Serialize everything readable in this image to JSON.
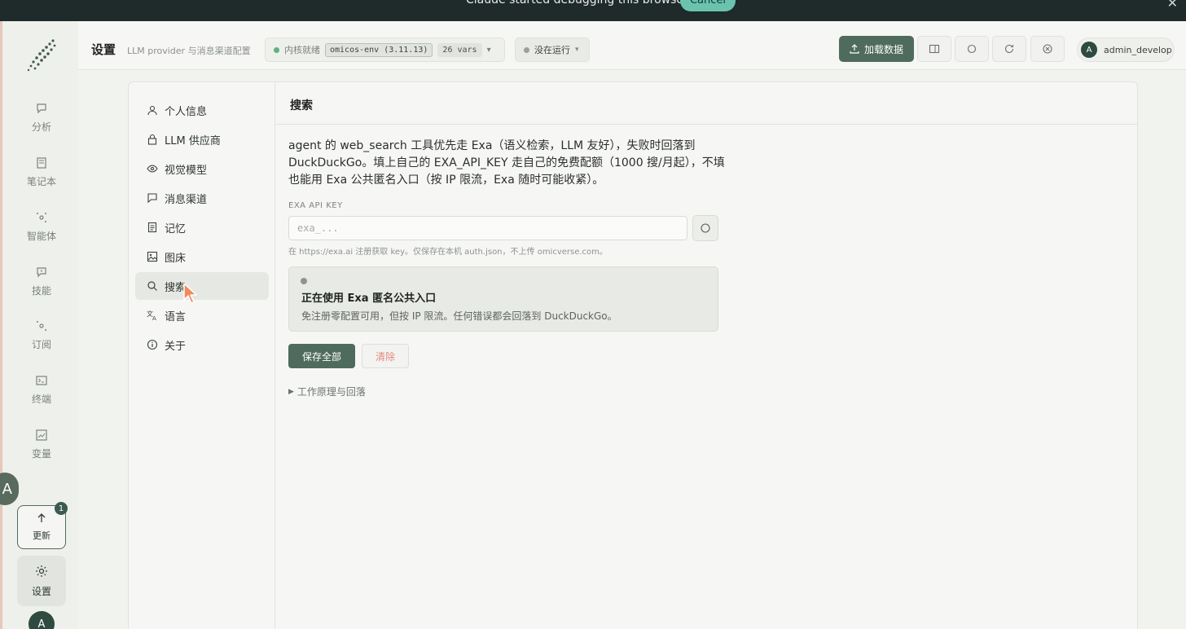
{
  "banner": {
    "message": "Claude started debugging this browser",
    "cancel_label": "Cancel",
    "close_glyph": "✕"
  },
  "leftnav": {
    "items": [
      {
        "label": "分析",
        "icon": "chat-icon"
      },
      {
        "label": "笔记本",
        "icon": "notebook-icon"
      },
      {
        "label": "智能体",
        "icon": "agent-icon"
      },
      {
        "label": "技能",
        "icon": "skill-icon"
      },
      {
        "label": "订阅",
        "icon": "subscription-icon"
      },
      {
        "label": "终端",
        "icon": "terminal-icon"
      },
      {
        "label": "变量",
        "icon": "variables-icon"
      }
    ],
    "update_label": "更新",
    "update_count": "1",
    "settings_label": "设置",
    "avatar_letter": "A",
    "lang_glyph": "A"
  },
  "header": {
    "title": "设置",
    "subtitle": "LLM provider 与消息渠道配置",
    "kernel_status": "内核就绪",
    "env_chip": "omicos-env (3.11.13)",
    "vars_chip": "26 vars",
    "run_status": "没在运行",
    "load_button": "加载数据",
    "user_initial": "A",
    "user_name": "admin_develop"
  },
  "settings_nav": [
    {
      "label": "个人信息",
      "icon": "user-icon"
    },
    {
      "label": "LLM 供应商",
      "icon": "lock-icon"
    },
    {
      "label": "视觉模型",
      "icon": "eye-icon"
    },
    {
      "label": "消息渠道",
      "icon": "message-icon"
    },
    {
      "label": "记忆",
      "icon": "memory-icon"
    },
    {
      "label": "图床",
      "icon": "image-icon"
    },
    {
      "label": "搜索",
      "icon": "search-icon",
      "active": true
    },
    {
      "label": "语言",
      "icon": "translate-icon"
    },
    {
      "label": "关于",
      "icon": "info-icon"
    }
  ],
  "search": {
    "heading": "搜索",
    "description": "agent 的 web_search 工具优先走 Exa（语义检索，LLM 友好），失败时回落到 DuckDuckGo。填上自己的 EXA_API_KEY 走自己的免费配额（1000 搜/月起），不填也能用 Exa 公共匿名入口（按 IP 限流，Exa 随时可能收紧）。",
    "api_key_label": "EXA API KEY",
    "api_key_value": "",
    "api_key_placeholder": "exa_...",
    "hint": "在 https://exa.ai 注册获取 key。仅保存在本机 auth.json，不上传 omicverse.com。",
    "status_title": "正在使用 Exa 匿名公共入口",
    "status_desc": "免注册零配置可用，但按 IP 限流。任何错误都会回落到 DuckDuckGo。",
    "save_label": "保存全部",
    "clear_label": "清除",
    "how_label": "工作原理与回落"
  },
  "colors": {
    "accent": "#4f6b5e",
    "danger_text": "#e28a80",
    "banner_bg": "#1f2a2a",
    "banner_button": "#6cc3ad"
  }
}
